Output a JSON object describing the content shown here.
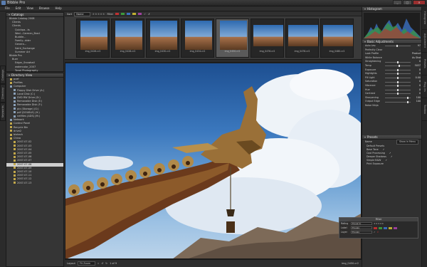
{
  "window": {
    "title": "Bibble Pro",
    "buttons": [
      "_",
      "□",
      "✕"
    ]
  },
  "menu": [
    "File",
    "Edit",
    "View",
    "Browse",
    "Help"
  ],
  "catalog": {
    "title": "Catalogs",
    "items": [
      {
        "label": "Bibble Catalog 2008",
        "indent": 1
      },
      {
        "label": "Clients",
        "indent": 2
      },
      {
        "label": "Clients",
        "indent": 2
      },
      {
        "label": "Quickpa...ts",
        "indent": 3
      },
      {
        "label": "Wed...Carmen_Brad",
        "indent": 3
      },
      {
        "label": "Buddie...",
        "indent": 3
      },
      {
        "label": "Family...dder",
        "indent": 3
      },
      {
        "label": "Genera...",
        "indent": 3
      },
      {
        "label": "Saint_Exchange",
        "indent": 3
      },
      {
        "label": "Summer Art",
        "indent": 3
      },
      {
        "label": "Bibble Pro",
        "indent": 1
      },
      {
        "label": "Buer",
        "indent": 2
      },
      {
        "label": "Edgar_Snowball",
        "indent": 3
      },
      {
        "label": "watercolor_2007",
        "indent": 3
      },
      {
        "label": "Tonal Photography",
        "indent": 3
      },
      {
        "label": "Holyfunders",
        "indent": 3
      }
    ]
  },
  "directory": {
    "title": "Directory View",
    "items": [
      {
        "label": "pcef",
        "indent": 1,
        "type": "folder"
      },
      {
        "label": "Profiles",
        "indent": 1,
        "type": "folder"
      },
      {
        "label": "Computer",
        "indent": 1,
        "type": "drive"
      },
      {
        "label": "Floppy Disk Drive (A:)",
        "indent": 2,
        "type": "drive"
      },
      {
        "label": "Local Disk (C:)",
        "indent": 2,
        "type": "drive"
      },
      {
        "label": "DVD RW Drive (D:)",
        "indent": 2,
        "type": "drive"
      },
      {
        "label": "Removable Disk (E:)",
        "indent": 2,
        "type": "drive"
      },
      {
        "label": "Removable Disk (F:)",
        "indent": 2,
        "type": "drive"
      },
      {
        "label": "pix (Storage) (G:)",
        "indent": 2,
        "type": "drive"
      },
      {
        "label": "pdf (DOUBLE) (H:)",
        "indent": 2,
        "type": "drive"
      },
      {
        "label": "netfiles (ADS) (M:)",
        "indent": 2,
        "type": "drive"
      },
      {
        "label": "Network",
        "indent": 1,
        "type": "drive"
      },
      {
        "label": "Control Panel",
        "indent": 1,
        "type": "folder"
      },
      {
        "label": "Recycle Bin",
        "indent": 1,
        "type": "folder"
      },
      {
        "label": "drive2",
        "indent": 1,
        "type": "folder"
      },
      {
        "label": "biotech",
        "indent": 1,
        "type": "folder"
      },
      {
        "label": "China",
        "indent": 1,
        "type": "folder"
      },
      {
        "label": "2007-07-02",
        "indent": 2,
        "type": "folder"
      },
      {
        "label": "2007-07-03",
        "indent": 2,
        "type": "folder"
      },
      {
        "label": "2007-07-04",
        "indent": 2,
        "type": "folder"
      },
      {
        "label": "2007-07-05",
        "indent": 2,
        "type": "folder"
      },
      {
        "label": "2007-07-06",
        "indent": 2,
        "type": "folder"
      },
      {
        "label": "2007-07-07",
        "indent": 2,
        "type": "folder"
      },
      {
        "label": "2007-07-08",
        "indent": 2,
        "type": "folder",
        "selected": true
      },
      {
        "label": "2007-07-09",
        "indent": 2,
        "type": "folder"
      },
      {
        "label": "2007-07-10",
        "indent": 2,
        "type": "folder"
      },
      {
        "label": "2007-07-11",
        "indent": 2,
        "type": "folder"
      },
      {
        "label": "2007-07-12",
        "indent": 2,
        "type": "folder"
      },
      {
        "label": "2007-07-13",
        "indent": 2,
        "type": "folder"
      }
    ]
  },
  "left_tabs": [
    "Catalogs",
    "Directory",
    "Keywords"
  ],
  "filmstrip": {
    "sort_label": "Sort",
    "sort_value": "Name",
    "filter_label": "Filter",
    "stars": "★★★★★",
    "colors": [
      "#c03030",
      "#3b9a3b",
      "#3a6fc0",
      "#c0b030",
      "#a040a0"
    ],
    "thumbs": [
      {
        "name": "img_0426.cr2",
        "selected": false
      },
      {
        "name": "img_0428.cr2",
        "selected": false
      },
      {
        "name": "img_0430.cr2",
        "selected": false
      },
      {
        "name": "img_0434.cr2",
        "selected": false
      },
      {
        "name": "img_0450.cr2",
        "selected": true
      },
      {
        "name": "img_0476.cr2",
        "selected": false
      },
      {
        "name": "img_0478.cr2",
        "selected": false
      },
      {
        "name": "img_0480.cr2",
        "selected": false
      }
    ]
  },
  "viewer": {
    "filename": "img_0450.cr2",
    "bottom": {
      "layout": "Layout",
      "zoom": "Fit Zoom",
      "page": "1 of 9"
    }
  },
  "histogram": {
    "title": "Histogram",
    "range": [
      0,
      255
    ]
  },
  "basic": {
    "title": "Basic Adjustments",
    "rows": [
      {
        "label": "Auto Lev.",
        "value": "97",
        "pos": 0.48
      },
      {
        "label": "Perfectly Clear",
        "value": "...",
        "pos": 0
      },
      {
        "label": "Look Profile",
        "value": "Product",
        "pos": 0
      },
      {
        "label": "White Balance",
        "value": "As Shot",
        "pos": 0
      },
      {
        "label": "Straightening",
        "value": "0",
        "pos": 0.5
      },
      {
        "label": "Temp",
        "value": "5037",
        "pos": 0.55
      },
      {
        "label": "Exposure",
        "value": "0",
        "pos": 0.5
      },
      {
        "label": "Highlights",
        "value": "0",
        "pos": 0.5
      },
      {
        "label": "Fill Light",
        "value": "0.00",
        "pos": 0.5
      },
      {
        "label": "Saturation",
        "value": "0",
        "pos": 0.5
      },
      {
        "label": "Vibrance",
        "value": "0",
        "pos": 0.5
      },
      {
        "label": "Hue",
        "value": "0",
        "pos": 0.5
      },
      {
        "label": "Contrast",
        "value": "0",
        "pos": 0.5
      },
      {
        "label": "Sharpening",
        "value": "100",
        "pos": 0.9
      },
      {
        "label": "Output Edge",
        "value": "100",
        "pos": 0.9
      },
      {
        "label": "Noise Ninja",
        "value": "",
        "pos": 0
      }
    ]
  },
  "presets": {
    "title": "Presets",
    "search_label": "Name",
    "search_value": "Show in Menu",
    "items": [
      {
        "label": "Default Presets",
        "check": ""
      },
      {
        "label": "Base Tone",
        "check": "✓"
      },
      {
        "label": "Cool Processing",
        "check": "✓"
      },
      {
        "label": "Deeper Shadows",
        "check": "✓"
      },
      {
        "label": "Simple B&W",
        "check": "✓"
      },
      {
        "label": "Print Exposure",
        "check": ""
      }
    ]
  },
  "hud": {
    "title": "Filter",
    "rows": [
      {
        "label": "Rating",
        "value": "Equal to",
        "extra": "★★★★★"
      },
      {
        "label": "Label",
        "value": "Equals"
      },
      {
        "label": "Layer",
        "value": "Equals"
      }
    ],
    "colors": [
      "#c03030",
      "#3b9a3b",
      "#3a6fc0",
      "#c0b030",
      "#a040a0"
    ]
  },
  "side_tabs": [
    "Histogram",
    "Adjustment",
    "Presets",
    "Plug-ins",
    "Toolbox"
  ]
}
